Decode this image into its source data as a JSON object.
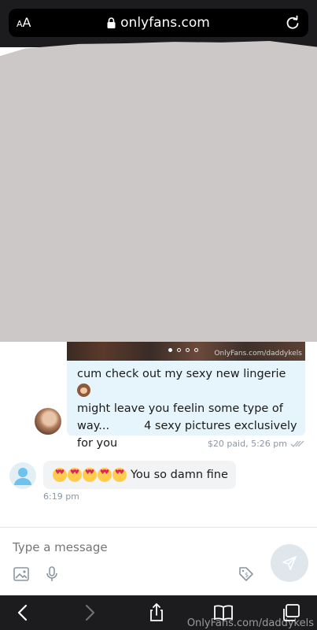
{
  "browser": {
    "text_size_label": "AA",
    "url": "onlyfans.com",
    "watermark": "OnlyFans.com/daddykels"
  },
  "media": {
    "watermark": "OnlyFans.com/daddykels",
    "carousel_pages": 4,
    "carousel_active": 1
  },
  "sent_message": {
    "text_line1": "cum check out my sexy new lingerie",
    "text_line2": "might leave you feelin some type of",
    "text_line3a": "way...",
    "text_line3b": "4 sexy pictures exclusively",
    "text_line4": "for you",
    "meta": "$20 paid,  5:26 pm"
  },
  "received_message": {
    "text": "You so damn fine",
    "time": "6:19 pm"
  },
  "composer": {
    "placeholder": "Type a message"
  },
  "colors": {
    "sent_bubble": "#e6f5fc",
    "received_bubble": "#f2f3f5",
    "accent_blue": "#00aff0",
    "redaction_gray": "#cdc8c8",
    "toolbar_bg": "#1c1c1e"
  }
}
